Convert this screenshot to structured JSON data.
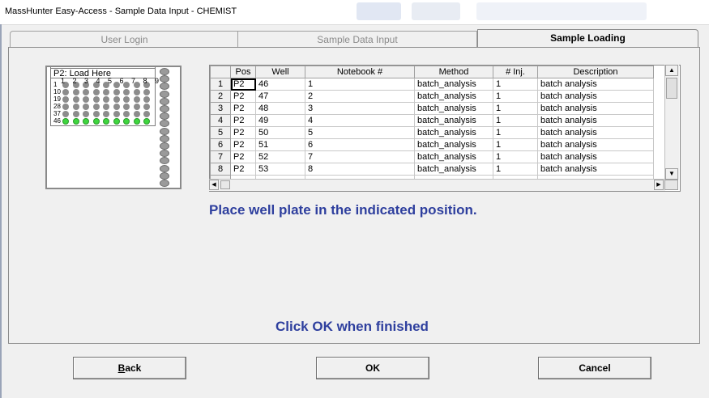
{
  "window": {
    "title": "MassHunter Easy-Access - Sample Data Input - CHEMIST"
  },
  "tabs": [
    {
      "label": "User Login",
      "active": false
    },
    {
      "label": "Sample Data Input",
      "active": false
    },
    {
      "label": "Sample Loading",
      "active": true
    }
  ],
  "plate": {
    "title": "P2: Load Here",
    "column_numbers": "1 2 3 4 5 6 7 8 9",
    "row_labels": [
      "1",
      "10",
      "19",
      "28",
      "37",
      "46"
    ],
    "loaded_row_label": "46"
  },
  "table": {
    "columns": [
      "Pos",
      "Well",
      "Notebook #",
      "Method",
      "# Inj.",
      "Description"
    ],
    "rows": [
      {
        "n": "1",
        "pos": "P2",
        "well": "46",
        "notebook": "1",
        "method": "batch_analysis",
        "inj": "1",
        "desc": "batch analysis"
      },
      {
        "n": "2",
        "pos": "P2",
        "well": "47",
        "notebook": "2",
        "method": "batch_analysis",
        "inj": "1",
        "desc": "batch analysis"
      },
      {
        "n": "3",
        "pos": "P2",
        "well": "48",
        "notebook": "3",
        "method": "batch_analysis",
        "inj": "1",
        "desc": "batch analysis"
      },
      {
        "n": "4",
        "pos": "P2",
        "well": "49",
        "notebook": "4",
        "method": "batch_analysis",
        "inj": "1",
        "desc": "batch analysis"
      },
      {
        "n": "5",
        "pos": "P2",
        "well": "50",
        "notebook": "5",
        "method": "batch_analysis",
        "inj": "1",
        "desc": "batch analysis"
      },
      {
        "n": "6",
        "pos": "P2",
        "well": "51",
        "notebook": "6",
        "method": "batch_analysis",
        "inj": "1",
        "desc": "batch analysis"
      },
      {
        "n": "7",
        "pos": "P2",
        "well": "52",
        "notebook": "7",
        "method": "batch_analysis",
        "inj": "1",
        "desc": "batch analysis"
      },
      {
        "n": "8",
        "pos": "P2",
        "well": "53",
        "notebook": "8",
        "method": "batch_analysis",
        "inj": "1",
        "desc": "batch analysis"
      }
    ]
  },
  "messages": {
    "place": "Place well plate in the indicated position.",
    "click_ok": "Click OK when finished"
  },
  "buttons": {
    "back_prefix": "",
    "back_mnemonic": "B",
    "back_rest": "ack",
    "ok": "OK",
    "cancel": "Cancel"
  },
  "colors": {
    "message_text": "#2e3f9e",
    "loaded_well": "#3ed63e",
    "empty_well": "#8c8c8c"
  }
}
